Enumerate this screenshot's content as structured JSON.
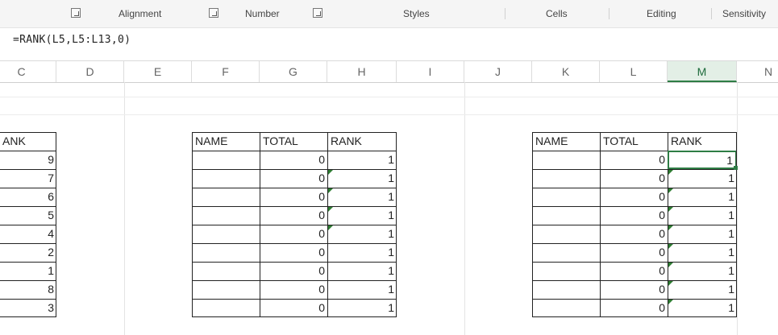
{
  "ribbon": {
    "alignment": "Alignment",
    "number": "Number",
    "styles": "Styles",
    "cells": "Cells",
    "editing": "Editing",
    "sensitivity": "Sensitivity"
  },
  "formula_bar": {
    "formula": "=RANK(L5,L5:L13,0)"
  },
  "columns": [
    "C",
    "D",
    "E",
    "F",
    "G",
    "H",
    "I",
    "J",
    "K",
    "L",
    "M",
    "N"
  ],
  "selected_column": "M",
  "table_left": {
    "header": "ANK",
    "ranks": [
      "9",
      "7",
      "6",
      "5",
      "4",
      "2",
      "1",
      "8",
      "3"
    ]
  },
  "table_middle": {
    "headers": [
      "NAME",
      "TOTAL",
      "RANK"
    ],
    "totals": [
      "0",
      "0",
      "0",
      "0",
      "0",
      "0",
      "0",
      "0",
      "0"
    ],
    "ranks": [
      "1",
      "1",
      "1",
      "1",
      "1",
      "1",
      "1",
      "1",
      "1"
    ]
  },
  "table_right": {
    "headers": [
      "NAME",
      "TOTAL",
      "RANK"
    ],
    "totals": [
      "0",
      "0",
      "0",
      "0",
      "0",
      "0",
      "0",
      "0",
      "0"
    ],
    "ranks": [
      "1",
      "1",
      "1",
      "1",
      "1",
      "1",
      "1",
      "1",
      "1"
    ]
  }
}
